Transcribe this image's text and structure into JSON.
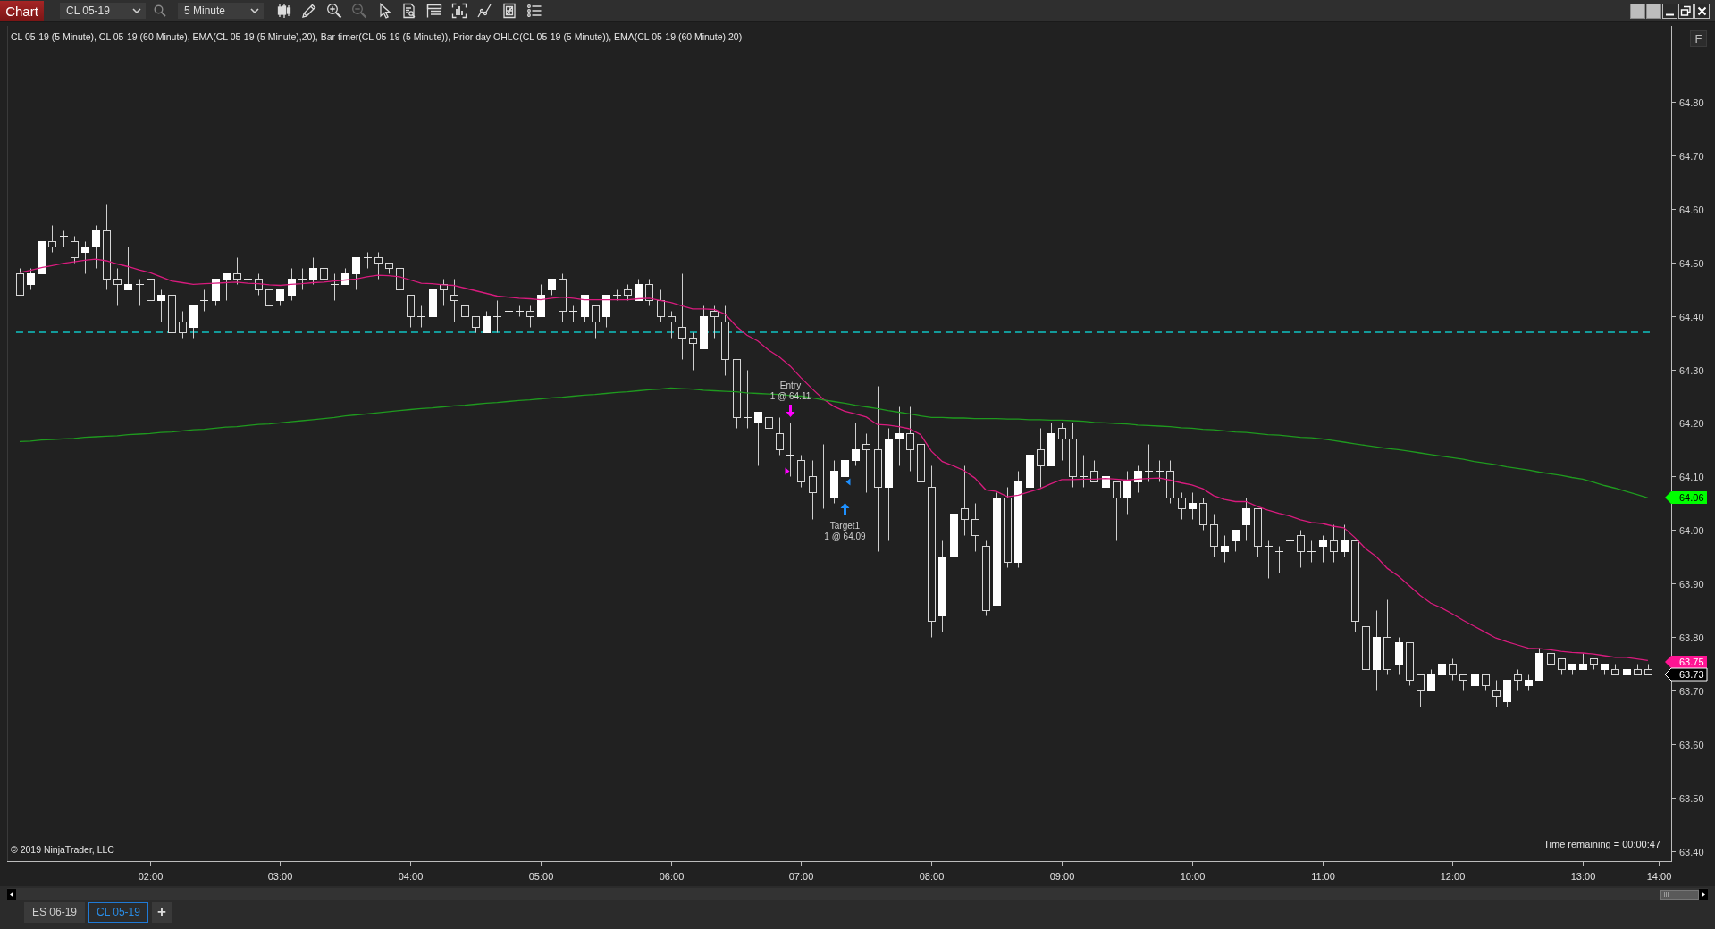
{
  "toolbar": {
    "app_button": "Chart",
    "instrument": "CL 05-19",
    "interval": "5 Minute",
    "tools": [
      {
        "kind": "bars",
        "disabled": false
      },
      {
        "kind": "draw",
        "disabled": false
      },
      {
        "kind": "zoom_in",
        "disabled": false
      },
      {
        "kind": "zoom_out",
        "disabled": true
      },
      {
        "kind": "select",
        "disabled": false
      },
      {
        "kind": "data_search",
        "disabled": false
      },
      {
        "kind": "table",
        "disabled": false
      },
      {
        "kind": "bracket",
        "disabled": false
      },
      {
        "kind": "strategy",
        "disabled": false
      },
      {
        "kind": "properties",
        "disabled": false
      },
      {
        "kind": "list",
        "disabled": false
      }
    ]
  },
  "chart": {
    "f_button": "F",
    "copyright": "© 2019 NinjaTrader, LLC",
    "bar_timer": "Time remaining = 00:00:47",
    "price_tags": [
      {
        "label": "64.06",
        "color": "#00ff00"
      },
      {
        "label": "63.75",
        "color": "#ff1493"
      },
      {
        "label": "63.73",
        "color": "#000000"
      }
    ],
    "executions": [
      {
        "kind": "sell",
        "label": "Entry",
        "detail": "1 @ 64.11"
      },
      {
        "kind": "buy",
        "label": "Target1",
        "detail": "1 @ 64.09"
      }
    ],
    "chart_data": [
      {
        "type": "candlestick",
        "title": "CL 05-19 (5 Minute), CL 05-19 (60 Minute), EMA(CL 05-19 (5 Minute),20), Bar timer(CL 05-19 (5 Minute)), Prior day OHLC(CL 05-19 (5 Minute)), EMA(CL 05-19 (60 Minute),20)",
        "categories": [
          null,
          null,
          null,
          null,
          null,
          null,
          null,
          null,
          null,
          null,
          null,
          null,
          "02:00",
          null,
          null,
          null,
          null,
          null,
          null,
          null,
          null,
          null,
          null,
          null,
          "03:00",
          null,
          null,
          null,
          null,
          null,
          null,
          null,
          null,
          null,
          null,
          null,
          "04:00",
          null,
          null,
          null,
          null,
          null,
          null,
          null,
          null,
          null,
          null,
          null,
          "05:00",
          null,
          null,
          null,
          null,
          null,
          null,
          null,
          null,
          null,
          null,
          null,
          "06:00",
          null,
          null,
          null,
          null,
          null,
          null,
          null,
          null,
          null,
          null,
          null,
          "07:00",
          null,
          null,
          null,
          null,
          null,
          null,
          null,
          null,
          null,
          null,
          null,
          "08:00",
          null,
          null,
          null,
          null,
          null,
          null,
          null,
          null,
          null,
          null,
          null,
          "09:00",
          null,
          null,
          null,
          null,
          null,
          null,
          null,
          null,
          null,
          null,
          null,
          "10:00",
          null,
          null,
          null,
          null,
          null,
          null,
          null,
          null,
          null,
          null,
          null,
          "11:00",
          null,
          null,
          null,
          null,
          null,
          null,
          null,
          null,
          null,
          null,
          null,
          "12:00",
          null,
          null,
          null,
          null,
          null,
          null,
          null,
          null,
          null,
          null,
          null,
          "13:00",
          null,
          null,
          null,
          null,
          null,
          null,
          "14:00"
        ],
        "ohlc": [
          [
            64.48,
            64.49,
            64.44,
            64.44
          ],
          [
            64.46,
            64.49,
            64.45,
            64.48
          ],
          [
            64.48,
            64.54,
            64.48,
            64.54
          ],
          [
            64.54,
            64.57,
            64.52,
            64.53
          ],
          [
            64.55,
            64.56,
            64.53,
            64.55
          ],
          [
            64.54,
            64.55,
            64.5,
            64.51
          ],
          [
            64.52,
            64.54,
            64.48,
            64.53
          ],
          [
            64.53,
            64.57,
            64.49,
            64.56
          ],
          [
            64.56,
            64.61,
            64.45,
            64.47
          ],
          [
            64.47,
            64.49,
            64.42,
            64.46
          ],
          [
            64.45,
            64.53,
            64.45,
            64.46
          ],
          [
            64.46,
            64.47,
            64.42,
            64.46
          ],
          [
            64.47,
            64.47,
            64.43,
            64.43
          ],
          [
            64.43,
            64.45,
            64.39,
            64.44
          ],
          [
            64.44,
            64.51,
            64.37,
            64.37
          ],
          [
            64.39,
            64.41,
            64.36,
            64.37
          ],
          [
            64.38,
            64.42,
            64.36,
            64.42
          ],
          [
            64.43,
            64.45,
            64.41,
            64.43
          ],
          [
            64.43,
            64.47,
            64.42,
            64.47
          ],
          [
            64.47,
            64.48,
            64.43,
            64.48
          ],
          [
            64.48,
            64.51,
            64.46,
            64.47
          ],
          [
            64.47,
            64.47,
            64.44,
            64.47
          ],
          [
            64.47,
            64.48,
            64.44,
            64.45
          ],
          [
            64.45,
            64.45,
            64.42,
            64.42
          ],
          [
            64.43,
            64.45,
            64.42,
            64.45
          ],
          [
            64.44,
            64.49,
            64.43,
            64.47
          ],
          [
            64.47,
            64.49,
            64.45,
            64.47
          ],
          [
            64.47,
            64.51,
            64.46,
            64.49
          ],
          [
            64.49,
            64.5,
            64.46,
            64.47
          ],
          [
            64.46,
            64.48,
            64.43,
            64.46
          ],
          [
            64.46,
            64.49,
            64.46,
            64.48
          ],
          [
            64.48,
            64.51,
            64.45,
            64.51
          ],
          [
            64.51,
            64.52,
            64.49,
            64.51
          ],
          [
            64.51,
            64.52,
            64.47,
            64.5
          ],
          [
            64.5,
            64.5,
            64.48,
            64.49
          ],
          [
            64.49,
            64.49,
            64.45,
            64.45
          ],
          [
            64.44,
            64.44,
            64.38,
            64.4
          ],
          [
            64.4,
            64.42,
            64.38,
            64.4
          ],
          [
            64.4,
            64.46,
            64.4,
            64.45
          ],
          [
            64.46,
            64.47,
            64.42,
            64.45
          ],
          [
            64.44,
            64.47,
            64.39,
            64.43
          ],
          [
            64.42,
            64.42,
            64.4,
            64.4
          ],
          [
            64.4,
            64.4,
            64.37,
            64.38
          ],
          [
            64.37,
            64.41,
            64.37,
            64.4
          ],
          [
            64.4,
            64.43,
            64.37,
            64.4
          ],
          [
            64.41,
            64.42,
            64.39,
            64.41
          ],
          [
            64.41,
            64.42,
            64.4,
            64.41
          ],
          [
            64.41,
            64.42,
            64.38,
            64.4
          ],
          [
            64.4,
            64.46,
            64.4,
            64.44
          ],
          [
            64.45,
            64.47,
            64.44,
            64.47
          ],
          [
            64.47,
            64.48,
            64.39,
            64.41
          ],
          [
            64.41,
            64.42,
            64.39,
            64.41
          ],
          [
            64.4,
            64.44,
            64.39,
            64.44
          ],
          [
            64.42,
            64.42,
            64.36,
            64.39
          ],
          [
            64.4,
            64.44,
            64.38,
            64.44
          ],
          [
            64.44,
            64.45,
            64.43,
            64.44
          ],
          [
            64.45,
            64.46,
            64.43,
            64.44
          ],
          [
            64.43,
            64.47,
            64.43,
            64.46
          ],
          [
            64.46,
            64.47,
            64.42,
            64.43
          ],
          [
            64.43,
            64.45,
            64.39,
            64.4
          ],
          [
            64.4,
            64.41,
            64.36,
            64.39
          ],
          [
            64.38,
            64.48,
            64.32,
            64.36
          ],
          [
            64.36,
            64.37,
            64.3,
            64.35
          ],
          [
            64.34,
            64.42,
            64.34,
            64.4
          ],
          [
            64.41,
            64.42,
            64.36,
            64.4
          ],
          [
            64.39,
            64.42,
            64.29,
            64.32
          ],
          [
            64.32,
            64.32,
            64.19,
            64.21
          ],
          [
            64.21,
            64.3,
            64.19,
            64.21
          ],
          [
            64.2,
            64.22,
            64.12,
            64.22
          ],
          [
            64.21,
            64.21,
            64.15,
            64.19
          ],
          [
            64.18,
            64.21,
            64.14,
            64.15
          ],
          [
            64.14,
            64.2,
            64.1,
            64.14
          ],
          [
            64.13,
            64.14,
            64.08,
            64.09
          ],
          [
            64.1,
            64.13,
            64.02,
            64.07
          ],
          [
            64.06,
            64.16,
            64.04,
            64.06
          ],
          [
            64.06,
            64.13,
            64.05,
            64.11
          ],
          [
            64.1,
            64.14,
            64.06,
            64.13
          ],
          [
            64.13,
            64.2,
            64.12,
            64.15
          ],
          [
            64.16,
            64.18,
            64.07,
            64.15
          ],
          [
            64.15,
            64.27,
            63.96,
            64.08
          ],
          [
            64.08,
            64.19,
            63.98,
            64.17
          ],
          [
            64.17,
            64.23,
            64.12,
            64.18
          ],
          [
            64.18,
            64.23,
            64.11,
            64.15
          ],
          [
            64.16,
            64.19,
            64.05,
            64.09
          ],
          [
            64.08,
            64.12,
            63.8,
            63.83
          ],
          [
            63.84,
            63.98,
            63.81,
            63.95
          ],
          [
            63.95,
            64.1,
            63.94,
            64.03
          ],
          [
            64.04,
            64.12,
            63.99,
            64.02
          ],
          [
            64.02,
            64.05,
            63.96,
            63.99
          ],
          [
            63.97,
            63.98,
            63.84,
            63.85
          ],
          [
            63.86,
            64.07,
            63.86,
            64.06
          ],
          [
            64.06,
            64.08,
            63.93,
            63.94
          ],
          [
            63.94,
            64.11,
            63.93,
            64.09
          ],
          [
            64.08,
            64.17,
            64.07,
            64.14
          ],
          [
            64.15,
            64.19,
            64.08,
            64.12
          ],
          [
            64.12,
            64.2,
            64.12,
            64.18
          ],
          [
            64.19,
            64.2,
            64.13,
            64.17
          ],
          [
            64.17,
            64.2,
            64.08,
            64.1
          ],
          [
            64.1,
            64.14,
            64.08,
            64.1
          ],
          [
            64.11,
            64.13,
            64.09,
            64.09
          ],
          [
            64.08,
            64.13,
            64.08,
            64.1
          ],
          [
            64.09,
            64.09,
            63.98,
            64.06
          ],
          [
            64.06,
            64.11,
            64.03,
            64.09
          ],
          [
            64.09,
            64.12,
            64.07,
            64.11
          ],
          [
            64.11,
            64.16,
            64.09,
            64.11
          ],
          [
            64.11,
            64.13,
            64.09,
            64.11
          ],
          [
            64.11,
            64.13,
            64.05,
            64.06
          ],
          [
            64.06,
            64.07,
            64.02,
            64.04
          ],
          [
            64.04,
            64.07,
            64.02,
            64.05
          ],
          [
            64.05,
            64.06,
            64.0,
            64.01
          ],
          [
            64.01,
            64.03,
            63.95,
            63.97
          ],
          [
            63.96,
            63.99,
            63.94,
            63.97
          ],
          [
            63.98,
            64.0,
            63.96,
            64.0
          ],
          [
            64.01,
            64.06,
            63.98,
            64.04
          ],
          [
            64.04,
            64.04,
            63.95,
            63.97
          ],
          [
            63.97,
            63.98,
            63.91,
            63.97
          ],
          [
            63.96,
            63.97,
            63.92,
            63.96
          ],
          [
            63.98,
            64.0,
            63.97,
            63.98
          ],
          [
            63.99,
            64.0,
            63.93,
            63.96
          ],
          [
            63.96,
            63.98,
            63.94,
            63.96
          ],
          [
            63.97,
            63.99,
            63.94,
            63.98
          ],
          [
            63.98,
            64.01,
            63.94,
            63.96
          ],
          [
            63.96,
            64.01,
            63.95,
            63.98
          ],
          [
            63.98,
            63.98,
            63.81,
            63.83
          ],
          [
            63.82,
            63.83,
            63.66,
            63.74
          ],
          [
            63.74,
            63.85,
            63.7,
            63.8
          ],
          [
            63.8,
            63.87,
            63.73,
            63.74
          ],
          [
            63.75,
            63.8,
            63.73,
            63.79
          ],
          [
            63.79,
            63.79,
            63.71,
            63.72
          ],
          [
            63.73,
            63.73,
            63.67,
            63.7
          ],
          [
            63.7,
            63.74,
            63.7,
            63.73
          ],
          [
            63.73,
            63.76,
            63.73,
            63.75
          ],
          [
            63.75,
            63.76,
            63.72,
            63.73
          ],
          [
            63.73,
            63.73,
            63.7,
            63.72
          ],
          [
            63.71,
            63.74,
            63.71,
            63.73
          ],
          [
            63.73,
            63.73,
            63.7,
            63.71
          ],
          [
            63.7,
            63.72,
            63.67,
            63.69
          ],
          [
            63.68,
            63.72,
            63.67,
            63.72
          ],
          [
            63.73,
            63.74,
            63.7,
            63.72
          ],
          [
            63.71,
            63.73,
            63.7,
            63.72
          ],
          [
            63.72,
            63.78,
            63.72,
            63.77
          ],
          [
            63.77,
            63.78,
            63.73,
            63.75
          ],
          [
            63.76,
            63.76,
            63.73,
            63.74
          ],
          [
            63.74,
            63.75,
            63.73,
            63.75
          ],
          [
            63.74,
            63.77,
            63.74,
            63.75
          ],
          [
            63.76,
            63.76,
            63.74,
            63.75
          ],
          [
            63.74,
            63.75,
            63.73,
            63.75
          ],
          [
            63.74,
            63.75,
            63.73,
            63.73
          ],
          [
            63.73,
            63.76,
            63.72,
            63.74
          ],
          [
            63.74,
            63.75,
            63.73,
            63.73
          ],
          [
            63.74,
            63.75,
            63.73,
            63.73
          ],
          null
        ],
        "series": [
          {
            "type": "line",
            "color": "#d81b7e",
            "values": [
              64.481,
              64.485,
              64.49,
              64.494,
              64.498,
              64.501,
              64.504,
              64.506,
              64.503,
              64.497,
              64.492,
              64.486,
              64.481,
              64.473,
              64.465,
              64.462,
              64.459,
              64.46,
              64.461,
              64.462,
              64.463,
              64.461,
              64.46,
              64.458,
              64.457,
              64.459,
              64.46,
              64.462,
              64.463,
              64.465,
              64.467,
              64.469,
              64.473,
              64.476,
              64.475,
              64.473,
              64.467,
              64.461,
              64.46,
              64.458,
              64.457,
              64.452,
              64.447,
              64.442,
              64.437,
              64.435,
              64.433,
              64.432,
              64.43,
              64.433,
              64.435,
              64.433,
              64.43,
              64.43,
              64.43,
              64.43,
              64.43,
              64.432,
              64.433,
              64.429,
              64.425,
              64.419,
              64.413,
              64.413,
              64.412,
              64.403,
              64.381,
              64.364,
              64.353,
              64.336,
              64.323,
              64.306,
              64.284,
              64.264,
              64.245,
              64.231,
              64.222,
              64.217,
              64.211,
              64.197,
              64.196,
              64.193,
              64.189,
              64.178,
              64.147,
              64.128,
              64.12,
              64.111,
              64.097,
              64.075,
              64.072,
              64.062,
              64.065,
              64.071,
              64.077,
              64.086,
              64.094,
              64.094,
              64.095,
              64.095,
              64.096,
              64.095,
              64.093,
              64.095,
              64.096,
              64.097,
              64.093,
              64.088,
              64.084,
              64.077,
              64.064,
              64.057,
              64.053,
              64.053,
              64.044,
              64.037,
              64.031,
              64.026,
              64.019,
              64.014,
              64.012,
              64.007,
              64.004,
              63.986,
              63.965,
              63.95,
              63.928,
              63.914,
              63.896,
              63.878,
              63.863,
              63.854,
              63.843,
              63.831,
              63.82,
              63.809,
              63.798,
              63.791,
              63.785,
              63.779,
              63.778,
              63.776,
              63.773,
              63.771,
              63.77,
              63.768,
              63.765,
              63.762,
              63.762,
              63.759,
              63.756,
              null
            ]
          },
          {
            "type": "line",
            "color": "#1f9a1f",
            "values": [
              64.165,
              64.166,
              64.168,
              64.169,
              64.17,
              64.171,
              64.173,
              64.174,
              64.175,
              64.176,
              64.178,
              64.179,
              64.18,
              64.182,
              64.183,
              64.185,
              64.187,
              64.188,
              64.19,
              64.192,
              64.193,
              64.195,
              64.197,
              64.198,
              64.2,
              64.202,
              64.204,
              64.206,
              64.208,
              64.21,
              64.213,
              64.215,
              64.217,
              64.219,
              64.221,
              64.223,
              64.225,
              64.227,
              64.228,
              64.23,
              64.232,
              64.233,
              64.235,
              64.237,
              64.238,
              64.24,
              64.242,
              64.243,
              64.245,
              64.247,
              64.248,
              64.25,
              64.252,
              64.253,
              64.255,
              64.257,
              64.258,
              64.26,
              64.262,
              64.263,
              64.265,
              64.264,
              64.263,
              64.261,
              64.26,
              64.259,
              64.258,
              64.256,
              64.255,
              64.254,
              64.253,
              64.251,
              64.25,
              64.247,
              64.243,
              64.24,
              64.237,
              64.233,
              64.23,
              64.227,
              64.223,
              64.22,
              64.217,
              64.213,
              64.21,
              64.21,
              64.209,
              64.209,
              64.208,
              64.208,
              64.208,
              64.207,
              64.207,
              64.206,
              64.206,
              64.205,
              64.205,
              64.204,
              64.203,
              64.201,
              64.2,
              64.199,
              64.198,
              64.196,
              64.195,
              64.194,
              64.193,
              64.191,
              64.19,
              64.188,
              64.187,
              64.185,
              64.183,
              64.182,
              64.18,
              64.178,
              64.177,
              64.175,
              64.173,
              64.172,
              64.17,
              64.167,
              64.164,
              64.161,
              64.158,
              64.155,
              64.152,
              64.15,
              64.147,
              64.144,
              64.141,
              64.138,
              64.135,
              64.132,
              64.128,
              64.125,
              64.122,
              64.118,
              64.115,
              64.112,
              64.108,
              64.105,
              64.102,
              64.098,
              64.095,
              64.089,
              64.083,
              64.078,
              64.072,
              64.066,
              64.06,
              null
            ]
          },
          {
            "type": "scatter",
            "color": "#ff00ff",
            "marker": "triangle",
            "values": [
              null,
              null,
              null,
              null,
              null,
              null,
              null,
              null,
              null,
              null,
              null,
              null,
              null,
              null,
              null,
              null,
              null,
              null,
              null,
              null,
              null,
              null,
              null,
              null,
              null,
              null,
              null,
              null,
              null,
              null,
              null,
              null,
              null,
              null,
              null,
              null,
              null,
              null,
              null,
              null,
              null,
              null,
              null,
              null,
              null,
              null,
              null,
              null,
              null,
              null,
              null,
              null,
              null,
              null,
              null,
              null,
              null,
              null,
              null,
              null,
              null,
              null,
              null,
              null,
              null,
              null,
              null,
              null,
              null,
              null,
              null,
              64.11,
              null,
              null,
              null,
              null,
              null,
              null,
              null,
              null,
              null,
              null,
              null,
              null,
              null,
              null,
              null,
              null,
              null,
              null,
              null,
              null,
              null,
              null,
              null,
              null,
              null,
              null,
              null,
              null,
              null,
              null,
              null,
              null,
              null,
              null,
              null,
              null,
              null,
              null,
              null,
              null,
              null,
              null,
              null,
              null,
              null,
              null,
              null,
              null,
              null,
              null,
              null,
              null,
              null,
              null,
              null,
              null,
              null,
              null,
              null,
              null,
              null,
              null,
              null,
              null,
              null,
              null,
              null,
              null,
              null,
              null,
              null,
              null,
              null,
              null,
              null,
              null,
              null,
              null,
              null,
              null
            ]
          },
          {
            "type": "scatter",
            "color": "#1e90ff",
            "marker": "triangle",
            "values": [
              null,
              null,
              null,
              null,
              null,
              null,
              null,
              null,
              null,
              null,
              null,
              null,
              null,
              null,
              null,
              null,
              null,
              null,
              null,
              null,
              null,
              null,
              null,
              null,
              null,
              null,
              null,
              null,
              null,
              null,
              null,
              null,
              null,
              null,
              null,
              null,
              null,
              null,
              null,
              null,
              null,
              null,
              null,
              null,
              null,
              null,
              null,
              null,
              null,
              null,
              null,
              null,
              null,
              null,
              null,
              null,
              null,
              null,
              null,
              null,
              null,
              null,
              null,
              null,
              null,
              null,
              null,
              null,
              null,
              null,
              null,
              null,
              null,
              null,
              null,
              null,
              64.09,
              null,
              null,
              null,
              null,
              null,
              null,
              null,
              null,
              null,
              null,
              null,
              null,
              null,
              null,
              null,
              null,
              null,
              null,
              null,
              null,
              null,
              null,
              null,
              null,
              null,
              null,
              null,
              null,
              null,
              null,
              null,
              null,
              null,
              null,
              null,
              null,
              null,
              null,
              null,
              null,
              null,
              null,
              null,
              null,
              null,
              null,
              null,
              null,
              null,
              null,
              null,
              null,
              null,
              null,
              null,
              null,
              null,
              null,
              null,
              null,
              null,
              null,
              null,
              null,
              null,
              null,
              null,
              null,
              null,
              null,
              null,
              null,
              null,
              null,
              null
            ]
          }
        ],
        "ref_lines": [
          {
            "axis": "y",
            "value": 64.37,
            "color": "#139a9a",
            "line_style": "dashed"
          }
        ],
        "ylim": [
          63.381,
          64.942
        ],
        "yticks": [
          {
            "value": 64.8,
            "label": "64.80"
          },
          {
            "value": 64.7,
            "label": "64.70"
          },
          {
            "value": 64.6,
            "label": "64.60"
          },
          {
            "value": 64.5,
            "label": "64.50"
          },
          {
            "value": 64.4,
            "label": "64.40"
          },
          {
            "value": 64.3,
            "label": "64.30"
          },
          {
            "value": 64.2,
            "label": "64.20"
          },
          {
            "value": 64.1,
            "label": "64.10"
          },
          {
            "value": 64.0,
            "label": "64.00"
          },
          {
            "value": 63.9,
            "label": "63.90"
          },
          {
            "value": 63.8,
            "label": "63.80"
          },
          {
            "value": 63.7,
            "label": "63.70"
          },
          {
            "value": 63.6,
            "label": "63.60"
          },
          {
            "value": 63.5,
            "label": "63.50"
          },
          {
            "value": 63.4,
            "label": "63.40"
          }
        ]
      }
    ]
  },
  "tabs": [
    {
      "label": "ES 06-19",
      "selected": false
    },
    {
      "label": "CL 05-19",
      "selected": true
    }
  ],
  "add_tab": "+"
}
